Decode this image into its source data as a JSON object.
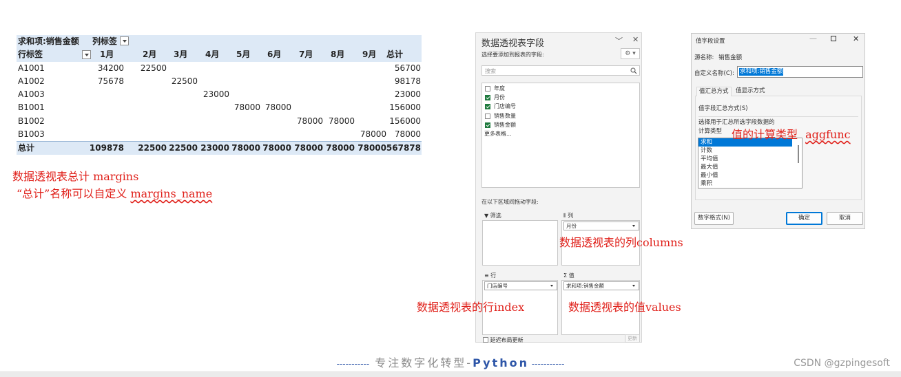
{
  "pivot": {
    "corner_label": "求和项:销售金额",
    "col_label": "列标签",
    "row_label": "行标签",
    "months": [
      "1月",
      "2月",
      "3月",
      "4月",
      "5月",
      "6月",
      "7月",
      "8月",
      "9月"
    ],
    "total_header": "总计",
    "rows": [
      {
        "label": "A1001",
        "cells": [
          "34200",
          "22500",
          "",
          "",
          "",
          "",
          "",
          "",
          ""
        ],
        "total": "56700"
      },
      {
        "label": "A1002",
        "cells": [
          "75678",
          "",
          "22500",
          "",
          "",
          "",
          "",
          "",
          ""
        ],
        "total": "98178"
      },
      {
        "label": "A1003",
        "cells": [
          "",
          "",
          "",
          "23000",
          "",
          "",
          "",
          "",
          ""
        ],
        "total": "23000"
      },
      {
        "label": "B1001",
        "cells": [
          "",
          "",
          "",
          "",
          "78000",
          "78000",
          "",
          "",
          ""
        ],
        "total": "156000"
      },
      {
        "label": "B1002",
        "cells": [
          "",
          "",
          "",
          "",
          "",
          "",
          "78000",
          "78000",
          ""
        ],
        "total": "156000"
      },
      {
        "label": "B1003",
        "cells": [
          "",
          "",
          "",
          "",
          "",
          "",
          "",
          "",
          "78000"
        ],
        "total": "78000"
      }
    ],
    "grand_total_label": "总计",
    "grand_totals": [
      "109878",
      "22500",
      "22500",
      "23000",
      "78000",
      "78000",
      "78000",
      "78000",
      "78000"
    ],
    "grand_total": "567878"
  },
  "annotations": {
    "margins_prefix": "数据透视表总计 margins",
    "margins_name_prefix": "“总计”名称可以自定义 ",
    "margins_name_param": "margins_name",
    "columns": "数据透视表的列columns",
    "index": "数据透视表的行index",
    "values": "数据透视表的值values",
    "calc_type": "值的计算类型",
    "aggfunc": "aggfunc"
  },
  "field_list": {
    "title": "数据透视表字段",
    "subtitle": "选择要添加到报表的字段:",
    "search_placeholder": "搜索",
    "fields": [
      {
        "label": "年度",
        "checked": false
      },
      {
        "label": "月份",
        "checked": true
      },
      {
        "label": "门店编号",
        "checked": true
      },
      {
        "label": "销售数量",
        "checked": false
      },
      {
        "label": "销售金额",
        "checked": true
      }
    ],
    "more_tables": "更多表格...",
    "drag_hint": "在以下区域间拖动字段:",
    "filter_label": "筛选",
    "columns_label": "列",
    "columns_value": "月份",
    "rows_label": "行",
    "rows_value": "门店编号",
    "values_label": "值",
    "values_value": "求和项:销售金额",
    "defer_label": "延迟布局更新",
    "update_button": "更新"
  },
  "dialog": {
    "title": "值字段设置",
    "source_label": "源名称:",
    "source_value": "销售金额",
    "custom_name_label": "自定义名称(C):",
    "custom_name_value": "求和项:销售金额",
    "tab_summarize": "值汇总方式",
    "tab_show": "值显示方式",
    "section_label": "值字段汇总方式(S)",
    "instruction": "选择用于汇总所选字段数据的",
    "calc_type_label": "计算类型",
    "calc_options": [
      "求和",
      "计数",
      "平均值",
      "最大值",
      "最小值",
      "乘积"
    ],
    "selected_option": "求和",
    "number_format_button": "数字格式(N)",
    "ok_button": "确定",
    "cancel_button": "取消"
  },
  "footer": {
    "dash_left": "-----------",
    "slogan_text": " 专注数字化转型-",
    "slogan_python": "Python",
    "dash_right": " -----------",
    "watermark": "CSDN @gzpingesoft"
  },
  "colors": {
    "annotation": "#e0201a",
    "pivot_header_bg": "#dde9f6",
    "checkbox_on": "#1f7a3e",
    "selected_option_bg": "#0078d7",
    "python_blue": "#2e56a8"
  }
}
